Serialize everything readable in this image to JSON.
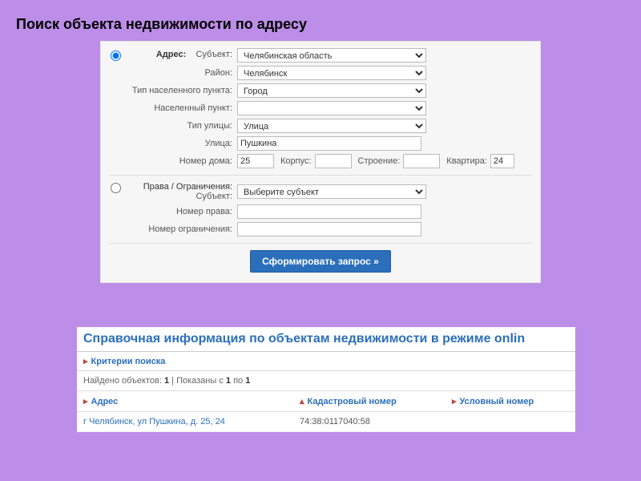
{
  "title": "Поиск объекта недвижимости по адресу",
  "form": {
    "address_radio_label": "Адрес:",
    "subject_label": "Субъект:",
    "subject_value": "Челябинская область",
    "district_label": "Район:",
    "district_value": "Челябинск",
    "settlement_type_label": "Тип населенного пункта:",
    "settlement_type_value": "Город",
    "settlement_label": "Населенный пункт:",
    "settlement_value": "",
    "street_type_label": "Тип улицы:",
    "street_type_value": "Улица",
    "street_label": "Улица:",
    "street_value": "Пушкина",
    "house_label": "Номер дома:",
    "house_value": "25",
    "korpus_label": "Корпус:",
    "korpus_value": "",
    "building_label": "Строение:",
    "building_value": "",
    "flat_label": "Квартира:",
    "flat_value": "24",
    "rights_radio_label": "Права / Ограничения:",
    "rights_subject_label": "Субъект:",
    "rights_subject_value": "Выберите субъект",
    "right_number_label": "Номер права:",
    "right_number_value": "",
    "restriction_number_label": "Номер ограничения:",
    "restriction_number_value": "",
    "submit_label": "Сформировать запрос »"
  },
  "results": {
    "title": "Справочная информация по объектам недвижимости в режиме onlin",
    "criteria_label": "Критерии поиска",
    "summary_prefix": "Найдено объектов: ",
    "summary_count": "1",
    "summary_mid": " | Показаны с ",
    "summary_from": "1",
    "summary_to_word": " по ",
    "summary_to": "1",
    "col_address": "Адрес",
    "col_cadastral": "Кадастровый номер",
    "col_conditional": "Условный номер",
    "row_address": "г Челябинск, ул Пушкина, д. 25, 24",
    "row_cadastral": "74:38:0117040:58",
    "row_conditional": ""
  }
}
